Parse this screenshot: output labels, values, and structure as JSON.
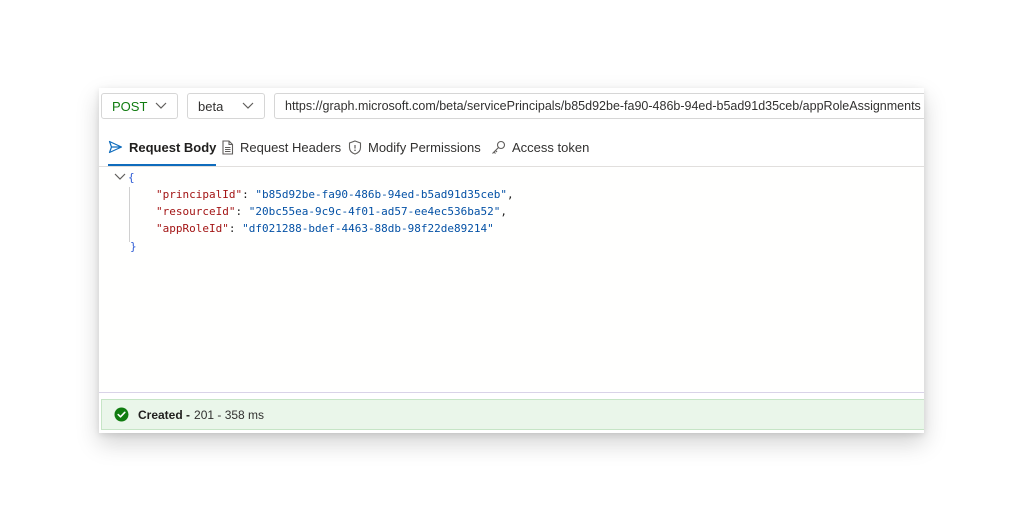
{
  "request": {
    "method": "POST",
    "version": "beta",
    "url": "https://graph.microsoft.com/beta/servicePrincipals/b85d92be-fa90-486b-94ed-b5ad91d35ceb/appRoleAssignments"
  },
  "tabs": [
    {
      "label": "Request Body",
      "icon": "send-icon",
      "active": true
    },
    {
      "label": "Request Headers",
      "icon": "document-icon"
    },
    {
      "label": "Modify Permissions",
      "icon": "shield-icon"
    },
    {
      "label": "Access token",
      "icon": "key-icon"
    }
  ],
  "body": {
    "open_brace": "{",
    "close_brace": "}",
    "fields": [
      {
        "key": "\"principalId\"",
        "value": "\"b85d92be-fa90-486b-94ed-b5ad91d35ceb\"",
        "trail": ","
      },
      {
        "key": "\"resourceId\"",
        "value": "\"20bc55ea-9c9c-4f01-ad57-ee4ec536ba52\"",
        "trail": ","
      },
      {
        "key": "\"appRoleId\"",
        "value": "\"df021288-bdef-4463-88db-98f22de89214\"",
        "trail": ""
      }
    ]
  },
  "status": {
    "text": "Created -",
    "meta": "201 - 358 ms",
    "color": "#107c10"
  },
  "colors": {
    "accent": "#0f6cbd",
    "method": "#107c10",
    "json_key": "#a31515",
    "json_string": "#0451a5"
  }
}
